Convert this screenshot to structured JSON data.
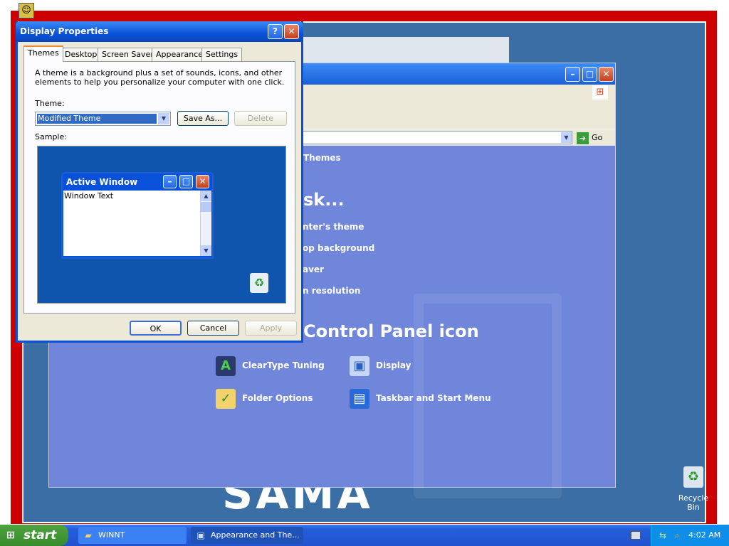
{
  "dialog": {
    "title": "Display Properties",
    "help_glyph": "?",
    "close_glyph": "✕",
    "tabs": [
      "Themes",
      "Desktop",
      "Screen Saver",
      "Appearance",
      "Settings"
    ],
    "description": "A theme is a background plus a set of sounds, icons, and other elements to help you personalize your computer with one click.",
    "theme_label": "Theme:",
    "theme_value": "Modified Theme",
    "save_as": "Save As...",
    "delete": "Delete",
    "sample_label": "Sample:",
    "ok": "OK",
    "cancel": "Cancel",
    "apply": "Apply"
  },
  "sample_window": {
    "title": "Active Window",
    "text": "Window Text"
  },
  "control_panel": {
    "side_link": "Themes",
    "pick_task": "sk...",
    "tasks": [
      "nter's theme",
      "op background",
      "aver",
      "n resolution"
    ],
    "or_pick": "Control Panel icon",
    "go_label": "Go",
    "icons": [
      "ClearType Tuning",
      "Display",
      "Folder Options",
      "Taskbar and Start Menu"
    ]
  },
  "desktop": {
    "logo_text": "SAMA",
    "recycle_bin": "Recycle Bin"
  },
  "taskbar": {
    "start": "start",
    "tasks": [
      "WINNT",
      "Appearance and The..."
    ],
    "clock": "4:02 AM"
  },
  "colors": {
    "xp_blue": "#0a51d9",
    "start_green": "#388b2c",
    "desktop_frame": "#cc0000",
    "control_panel_bg": "#6f86db"
  }
}
